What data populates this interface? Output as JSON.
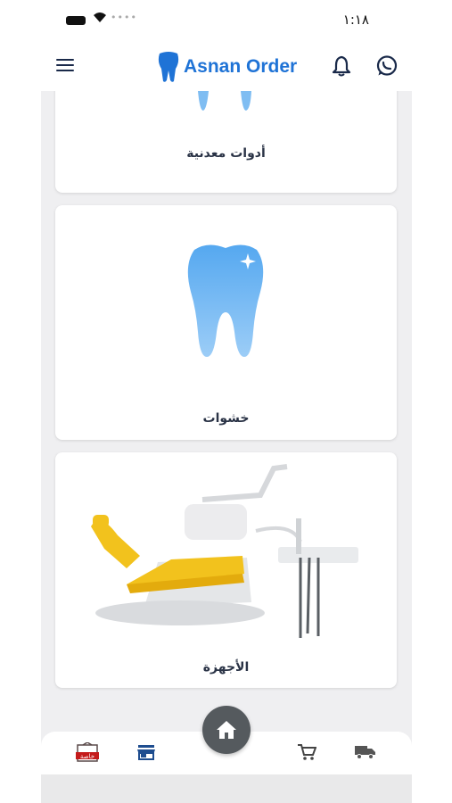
{
  "status": {
    "time": "١:١٨"
  },
  "app": {
    "title": "Asnan Order"
  },
  "categories": [
    {
      "label": "أدوات معدنية"
    },
    {
      "label": "خشوات"
    },
    {
      "label": "الأجهزة"
    }
  ],
  "nav": {
    "items": [
      "store-badge-icon",
      "shop-icon",
      "home-icon",
      "cart-icon",
      "truck-icon"
    ],
    "badge_text": "خاصة"
  },
  "colors": {
    "accent": "#1f73d6",
    "fab": "#555a5e",
    "tooth": "#62aef3"
  }
}
